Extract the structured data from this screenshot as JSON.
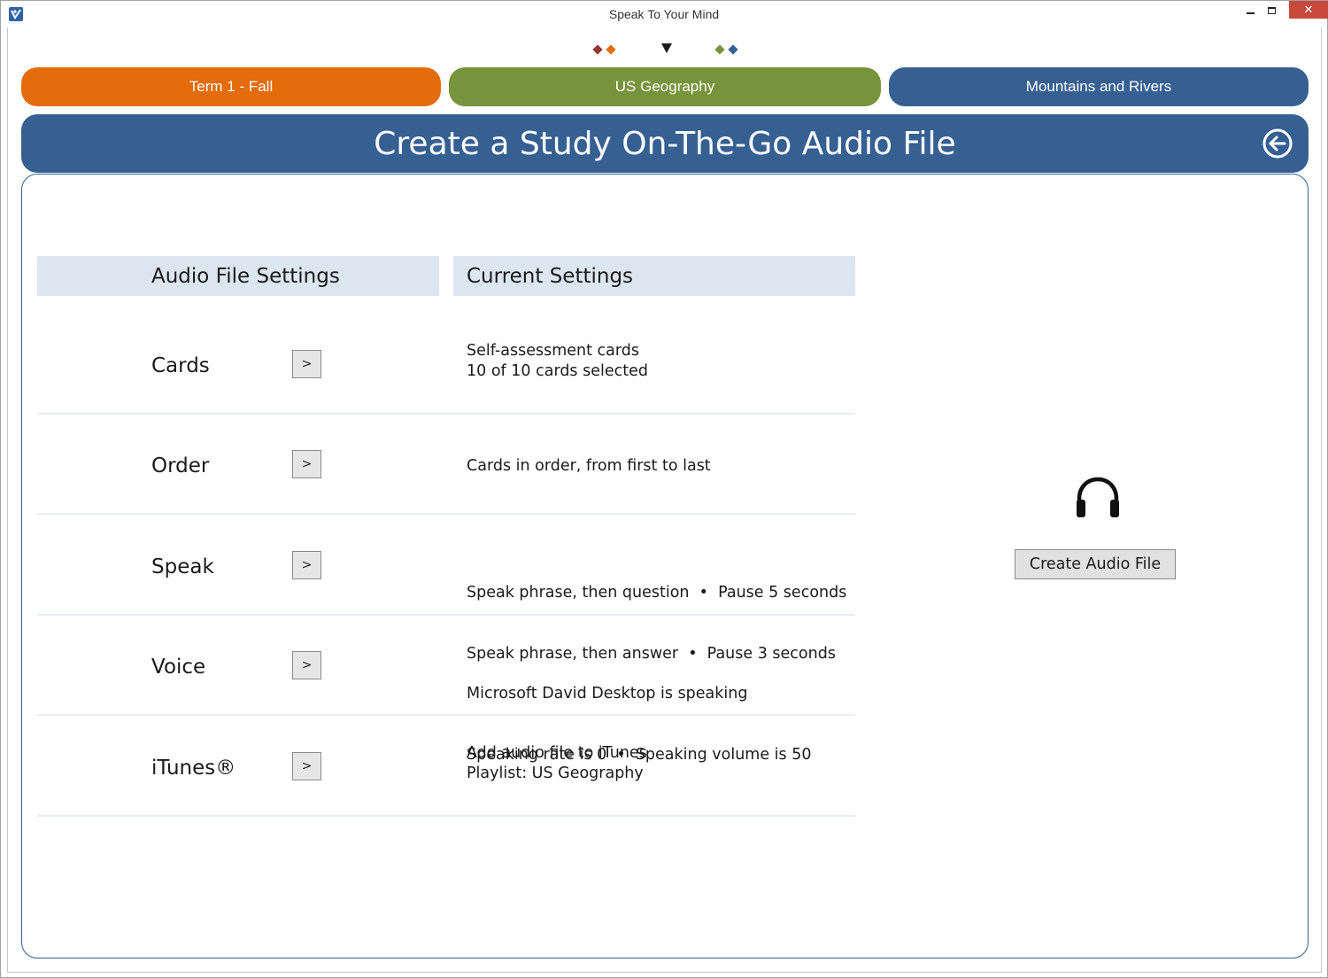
{
  "window": {
    "title": "Speak To Your Mind",
    "minimize_label": "",
    "maximize_label": "",
    "close_label": "✕"
  },
  "breadcrumb_marks": {
    "left_colors": [
      "#953735",
      "#e46c0a"
    ],
    "right_colors": [
      "#77933c",
      "#366092"
    ]
  },
  "tabs": {
    "term": "Term 1 - Fall",
    "subject": "US Geography",
    "topic": "Mountains and Rivers"
  },
  "colors": {
    "term": "#e46c0a",
    "subject": "#77933c",
    "topic": "#366092",
    "header": "#366092",
    "column_header": "#dce6f1"
  },
  "header": {
    "title": "Create a Study On-The-Go Audio File",
    "back_icon": "arrow-left-circle-icon"
  },
  "columns": {
    "settings": "Audio File Settings",
    "current": "Current Settings"
  },
  "rows": [
    {
      "label": "Cards",
      "button": ">",
      "lines": [
        "Self-assessment cards",
        "10 of 10 cards selected"
      ]
    },
    {
      "label": "Order",
      "button": ">",
      "lines": [
        "Cards in order, from first to last"
      ]
    },
    {
      "label": "Speak",
      "button": ">",
      "lines": [
        "Speak phrase, then question  •  Pause 5 seconds",
        "Speak phrase, then answer  •  Pause 3 seconds"
      ]
    },
    {
      "label": "Voice",
      "button": ">",
      "lines": [
        "Microsoft David Desktop is speaking",
        "Speaking rate is 0  •  Speaking volume is 50"
      ]
    },
    {
      "label": "iTunes®",
      "button": ">",
      "lines": [
        "Add audio file to iTunes",
        "Playlist: US Geography"
      ]
    }
  ],
  "action": {
    "icon": "headphones-icon",
    "create_label": "Create Audio File"
  }
}
